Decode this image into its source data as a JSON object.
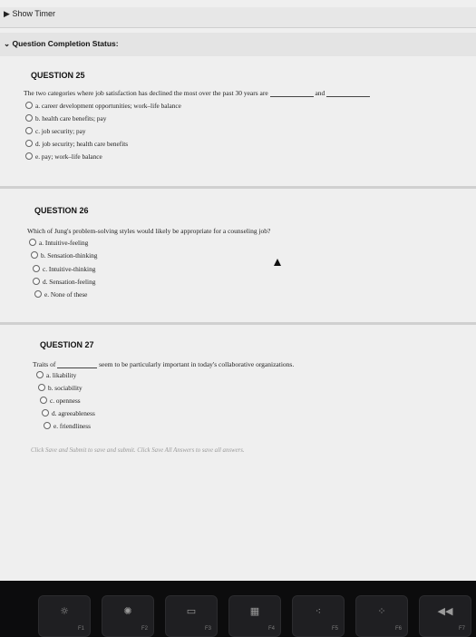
{
  "timer": {
    "label": "Show Timer"
  },
  "status": {
    "label": "Question Completion Status:"
  },
  "q25": {
    "title": "QUESTION 25",
    "text_a": "The two categories where job satisfaction has declined the most over the past 30 years are",
    "text_b": "and",
    "options": [
      "a. career development opportunities; work–life balance",
      "b. health care benefits; pay",
      "c. job security; pay",
      "d. job security; health care benefits",
      "e. pay; work–life balance"
    ]
  },
  "q26": {
    "title": "QUESTION 26",
    "text": "Which of Jung's problem-solving styles would likely be appropriate for a counseling job?",
    "options": [
      "a. Intuitive-feeling",
      "b. Sensation-thinking",
      "c. Intuitive-thinking",
      "d. Sensation-feeling",
      "e. None of these"
    ]
  },
  "q27": {
    "title": "QUESTION 27",
    "text_a": "Traits of",
    "text_b": "seem to be particularly important in today's collaborative organizations.",
    "options": [
      "a. likability",
      "b. sociability",
      "c. openness",
      "d. agreeableness",
      "e. friendliness"
    ]
  },
  "footer": {
    "note": "Click Save and Submit to save and submit. Click Save All Answers to save all answers."
  },
  "keys": [
    "F1",
    "F2",
    "F3",
    "F4",
    "F5",
    "F6",
    "F7"
  ]
}
